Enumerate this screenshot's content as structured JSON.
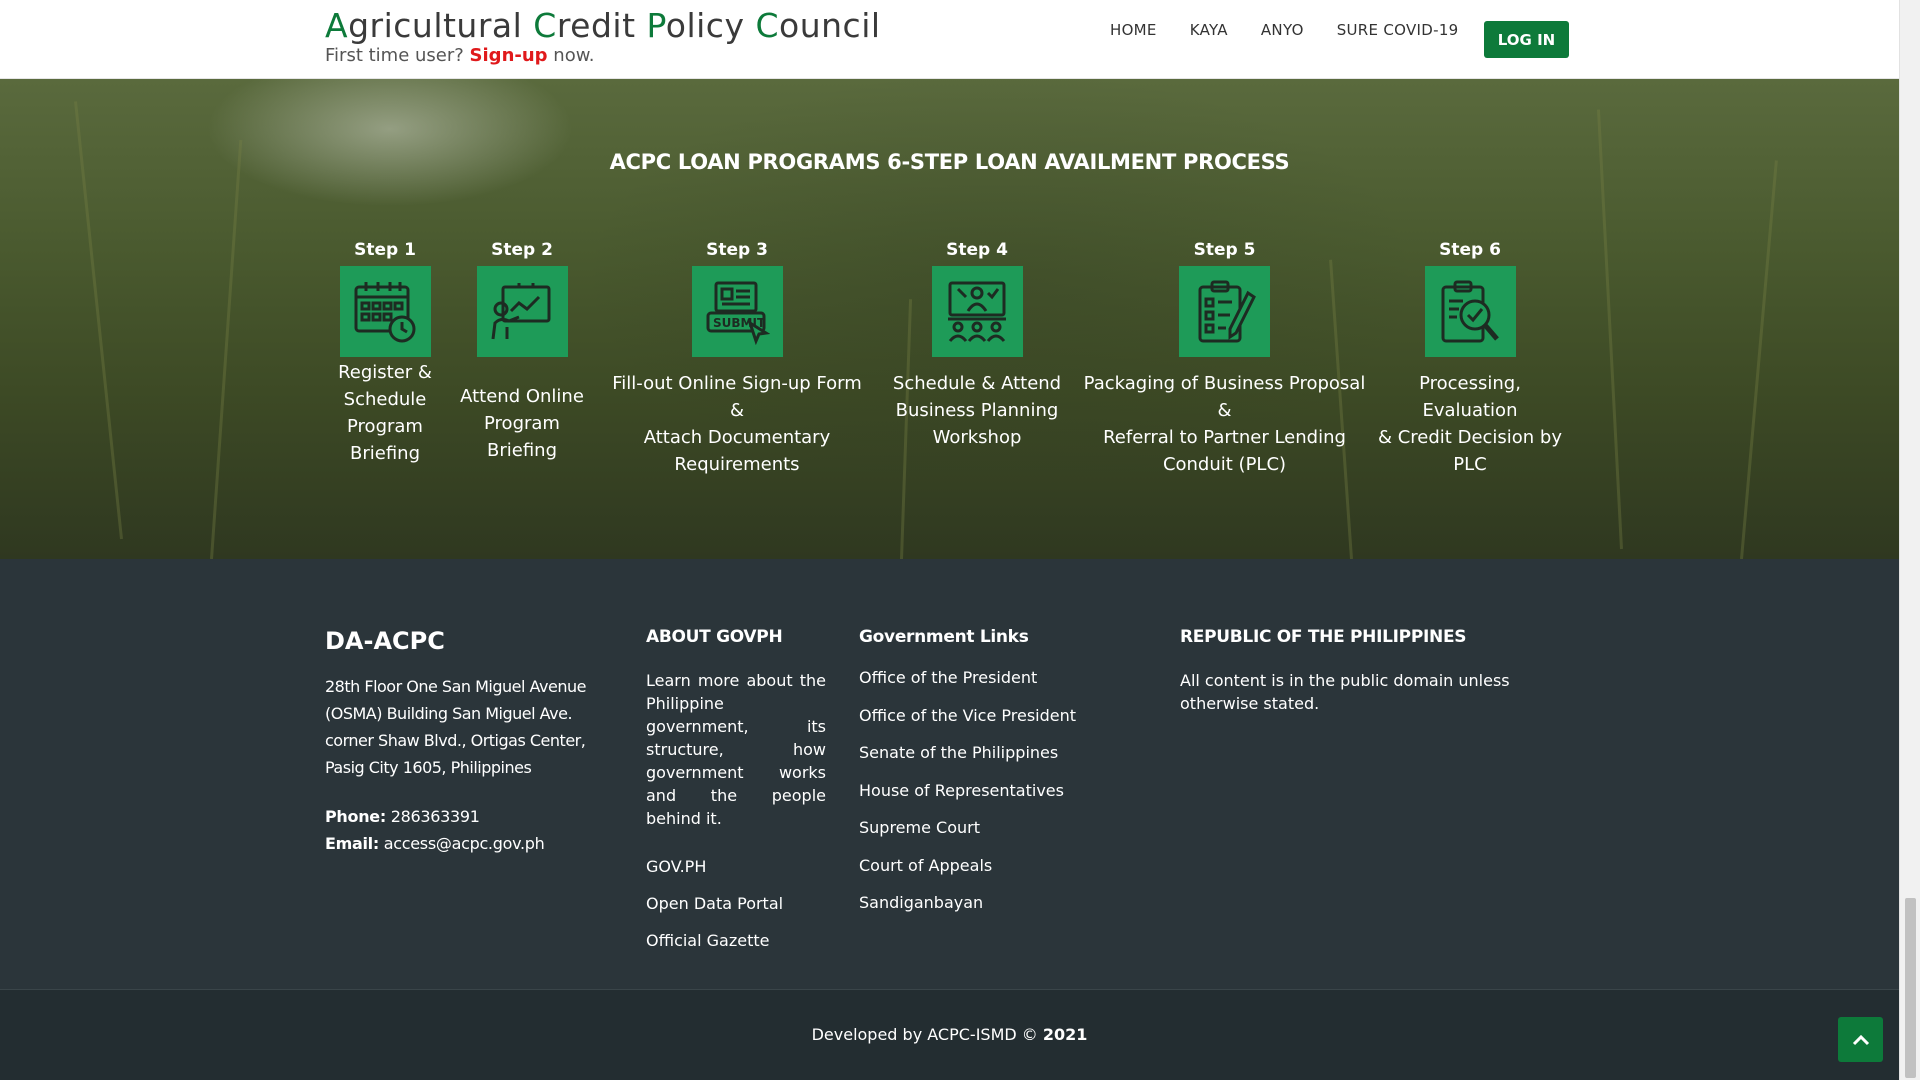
{
  "header": {
    "title_parts": [
      "A",
      "gricultural ",
      "C",
      "redit ",
      "P",
      "olicy ",
      "C",
      "ouncil"
    ],
    "subtitle_prefix": "First time user?",
    "subtitle_link": "Sign-up",
    "subtitle_suffix": "now.",
    "nav": [
      "HOME",
      "KAYA",
      "ANYO",
      "SURE COVID-19"
    ],
    "login_label": "LOG IN"
  },
  "hero": {
    "title": "ACPC LOAN PROGRAMS 6-STEP LOAN AVAILMENT PROCESS",
    "steps": [
      {
        "label": "Step 1",
        "icon": "calendar-clock-icon",
        "desc": [
          "Register &",
          "Schedule",
          "Program",
          "Briefing"
        ]
      },
      {
        "label": "Step 2",
        "icon": "online-presentation-icon",
        "desc": [
          "Attend Online",
          "Program Briefing"
        ]
      },
      {
        "label": "Step 3",
        "icon": "submit-form-icon",
        "desc": [
          "Fill-out Online Sign-up Form &",
          "Attach Documentary",
          "Requirements"
        ]
      },
      {
        "label": "Step 4",
        "icon": "workshop-meeting-icon",
        "desc": [
          "Schedule & Attend",
          "Business Planning",
          "Workshop"
        ]
      },
      {
        "label": "Step 5",
        "icon": "checklist-clipboard-icon",
        "desc": [
          "Packaging of Business Proposal &",
          "Referral to Partner Lending",
          "Conduit (PLC)"
        ]
      },
      {
        "label": "Step 6",
        "icon": "evaluation-magnifier-icon",
        "desc": [
          "Processing, Evaluation",
          "& Credit Decision by",
          "PLC"
        ]
      }
    ]
  },
  "footer": {
    "org_name": "DA-ACPC",
    "address": [
      "28th Floor One San Miguel Avenue",
      "(OSMA) Building San Miguel Ave.",
      "corner Shaw Blvd., Ortigas Center,",
      "Pasig City 1605, Philippines"
    ],
    "phone_label": "Phone:",
    "phone": "286363391",
    "email_label": "Email:",
    "email": "access@acpc.gov.ph",
    "about_heading": "ABOUT GOVPH",
    "about_text": "Learn more about the Philippine government, its structure, how government works and the people behind it.",
    "about_links": [
      "GOV.PH",
      "Open Data Portal",
      "Official Gazette"
    ],
    "gov_heading": "Government Links",
    "gov_links": [
      "Office of the President",
      "Office of the Vice President",
      "Senate of the Philippines",
      "House of Representatives",
      "Supreme Court",
      "Court of Appeals",
      "Sandiganbayan"
    ],
    "rp_heading": "REPUBLIC OF THE PHILIPPINES",
    "rp_text": "All content is in the public domain unless otherwise stated.",
    "copyright_prefix": "Developed by ACPC-ISMD ©",
    "copyright_year": "2021"
  },
  "colors": {
    "brand_green": "#0d7a3a",
    "step_icon_green": "#1e9b58",
    "signup_red": "#e0191b",
    "footer_bg": "#2b353a"
  }
}
